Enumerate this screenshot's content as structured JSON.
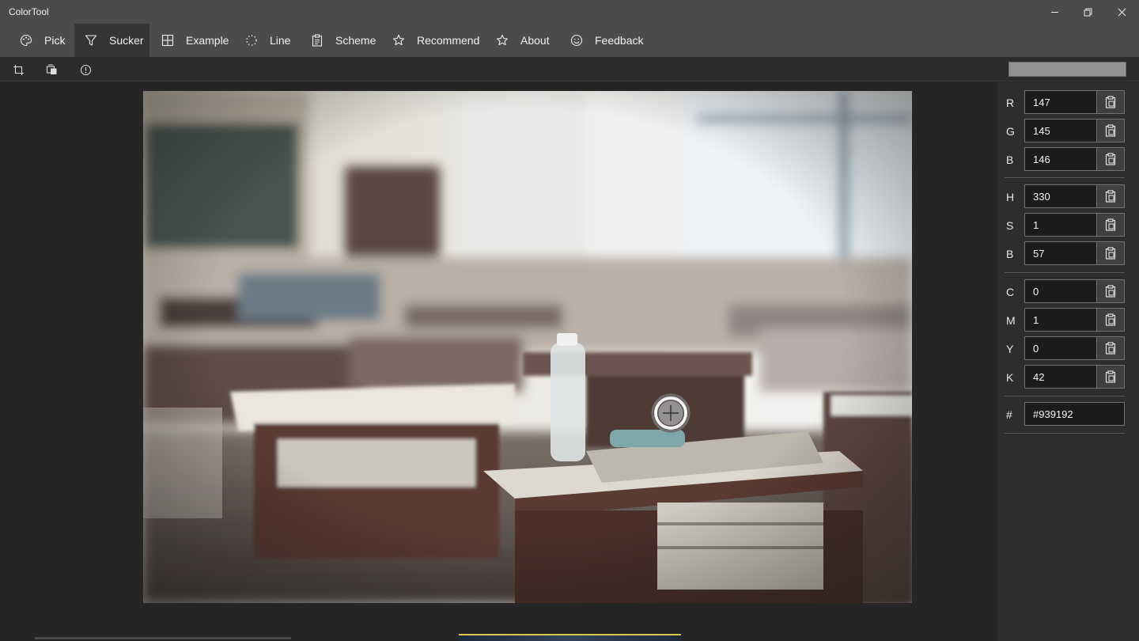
{
  "app": {
    "title": "ColorTool"
  },
  "window": {
    "minimize_icon": "minimize-icon",
    "restore_icon": "restore-icon",
    "close_icon": "close-icon"
  },
  "nav": {
    "active": "Sucker",
    "items": [
      {
        "label": "Pick",
        "icon": "palette-icon"
      },
      {
        "label": "Sucker",
        "icon": "funnel-icon"
      },
      {
        "label": "Example",
        "icon": "grid-icon"
      },
      {
        "label": "Line",
        "icon": "dotted-circle-icon"
      },
      {
        "label": "Scheme",
        "icon": "clipboard-list-icon"
      },
      {
        "label": "Recommend",
        "icon": "star-icon"
      },
      {
        "label": "About",
        "icon": "star-outline-icon"
      },
      {
        "label": "Feedback",
        "icon": "smiley-icon"
      }
    ]
  },
  "toolbar": {
    "tools": [
      {
        "icon": "crop-icon"
      },
      {
        "icon": "screen-capture-icon"
      },
      {
        "icon": "info-icon"
      }
    ],
    "picked_color": "#939192"
  },
  "image": {
    "description": "classroom photo"
  },
  "values": {
    "rgb": [
      {
        "label": "R",
        "value": "147"
      },
      {
        "label": "G",
        "value": "145"
      },
      {
        "label": "B",
        "value": "146"
      }
    ],
    "hsb": [
      {
        "label": "H",
        "value": "330"
      },
      {
        "label": "S",
        "value": "1"
      },
      {
        "label": "B",
        "value": "57"
      }
    ],
    "cmyk": [
      {
        "label": "C",
        "value": "0"
      },
      {
        "label": "M",
        "value": "1"
      },
      {
        "label": "Y",
        "value": "0"
      },
      {
        "label": "K",
        "value": "42"
      }
    ],
    "hex": {
      "label": "#",
      "value": "#939192"
    }
  },
  "colors": {
    "chrome": "#4b4b4b",
    "active_tab": "#353535",
    "background": "#252525",
    "sidebar": "#2d2d2d"
  }
}
